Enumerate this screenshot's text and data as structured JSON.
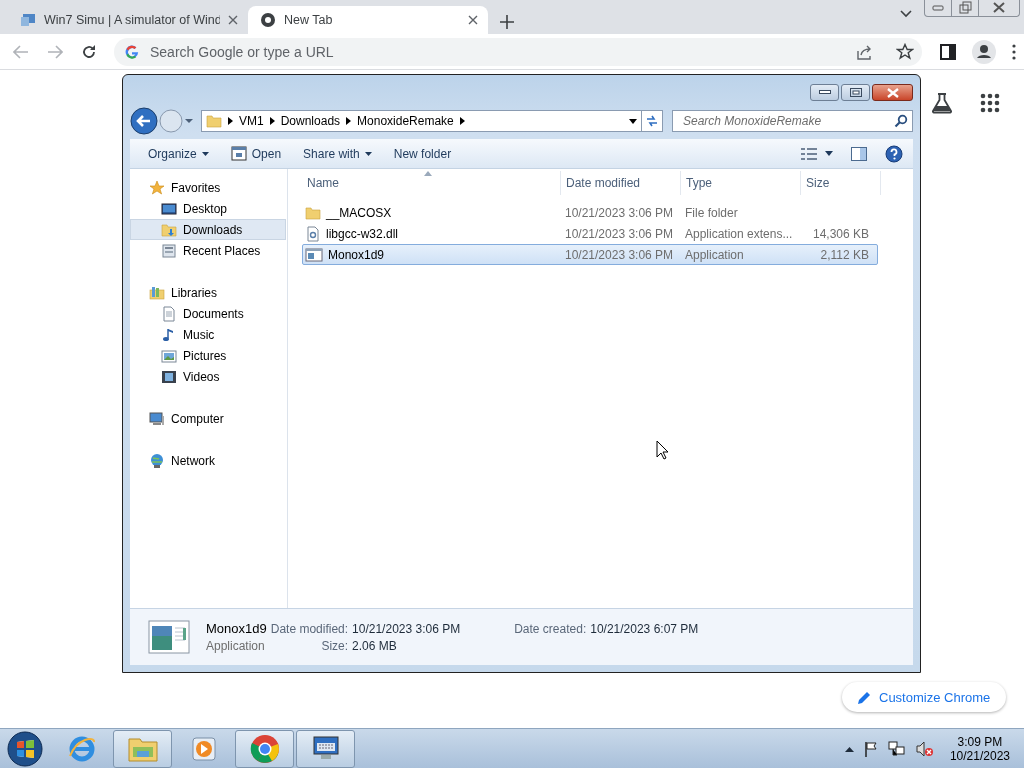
{
  "browser": {
    "tabs": [
      {
        "title": "Win7 Simu | A simulator of Wind",
        "selected": false
      },
      {
        "title": "New Tab",
        "selected": true
      }
    ],
    "omnibox": {
      "placeholder": "Search Google or type a URL"
    },
    "customize_button": "Customize Chrome"
  },
  "explorer": {
    "breadcrumb": [
      "VM1",
      "Downloads",
      "MonoxideRemake"
    ],
    "search": {
      "placeholder": "Search MonoxideRemake"
    },
    "commands": [
      {
        "label": "Organize",
        "kind": "menu"
      },
      {
        "label": "Open",
        "kind": "icon"
      },
      {
        "label": "Share with",
        "kind": "menu"
      },
      {
        "label": "New folder",
        "kind": "plain"
      }
    ],
    "navigation": [
      {
        "label": "Favorites",
        "selected": false,
        "children": [
          {
            "label": "Desktop",
            "selected": false
          },
          {
            "label": "Downloads",
            "selected": true
          },
          {
            "label": "Recent Places",
            "selected": false
          }
        ]
      },
      {
        "label": "Libraries",
        "selected": false,
        "children": [
          {
            "label": "Documents",
            "selected": false
          },
          {
            "label": "Music",
            "selected": false
          },
          {
            "label": "Pictures",
            "selected": false
          },
          {
            "label": "Videos",
            "selected": false
          }
        ]
      },
      {
        "label": "Computer",
        "selected": false
      },
      {
        "label": "Network",
        "selected": false
      }
    ],
    "columns": [
      {
        "label": "Name",
        "sorted": true
      },
      {
        "label": "Date modified",
        "sorted": false
      },
      {
        "label": "Type",
        "sorted": false
      },
      {
        "label": "Size",
        "sorted": false
      }
    ],
    "files": [
      {
        "kind": "folder",
        "name": "__MACOSX",
        "date": "10/21/2023 3:06 PM",
        "type": "File folder",
        "selected": false
      },
      {
        "kind": "library",
        "name": "libgcc-w32.dll",
        "date": "10/21/2023 3:06 PM",
        "type": "Application extens...",
        "size": "14,306 KB",
        "selected": false
      },
      {
        "kind": "application",
        "name": "Monox1d9",
        "date": "10/21/2023 3:06 PM",
        "type": "Application",
        "size": "2,112 KB",
        "selected": true
      }
    ],
    "details": {
      "name": "Monox1d9",
      "type": "Application",
      "fields": [
        {
          "label": "Date modified:",
          "value": "10/21/2023 3:06 PM"
        },
        {
          "label": "Size:",
          "value": "2.06 MB"
        },
        {
          "label": "Date created:",
          "value": "10/21/2023 6:07 PM"
        }
      ]
    }
  },
  "taskbar": {
    "apps": [
      {
        "running": false
      },
      {
        "running": true
      },
      {
        "running": false
      },
      {
        "running": true
      },
      {
        "running": true
      }
    ],
    "time": "3:09 PM",
    "date": "10/21/2023"
  }
}
